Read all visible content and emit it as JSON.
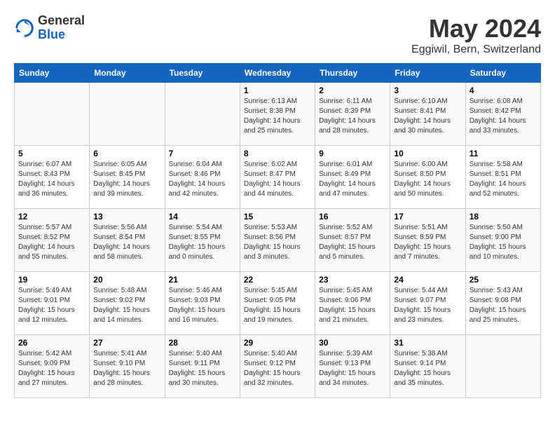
{
  "header": {
    "logo_general": "General",
    "logo_blue": "Blue",
    "month_title": "May 2024",
    "location": "Eggiwil, Bern, Switzerland"
  },
  "days_of_week": [
    "Sunday",
    "Monday",
    "Tuesday",
    "Wednesday",
    "Thursday",
    "Friday",
    "Saturday"
  ],
  "weeks": [
    [
      {
        "day": "",
        "info": ""
      },
      {
        "day": "",
        "info": ""
      },
      {
        "day": "",
        "info": ""
      },
      {
        "day": "1",
        "info": "Sunrise: 6:13 AM\nSunset: 8:38 PM\nDaylight: 14 hours and 25 minutes."
      },
      {
        "day": "2",
        "info": "Sunrise: 6:11 AM\nSunset: 8:39 PM\nDaylight: 14 hours and 28 minutes."
      },
      {
        "day": "3",
        "info": "Sunrise: 6:10 AM\nSunset: 8:41 PM\nDaylight: 14 hours and 30 minutes."
      },
      {
        "day": "4",
        "info": "Sunrise: 6:08 AM\nSunset: 8:42 PM\nDaylight: 14 hours and 33 minutes."
      }
    ],
    [
      {
        "day": "5",
        "info": "Sunrise: 6:07 AM\nSunset: 8:43 PM\nDaylight: 14 hours and 36 minutes."
      },
      {
        "day": "6",
        "info": "Sunrise: 6:05 AM\nSunset: 8:45 PM\nDaylight: 14 hours and 39 minutes."
      },
      {
        "day": "7",
        "info": "Sunrise: 6:04 AM\nSunset: 8:46 PM\nDaylight: 14 hours and 42 minutes."
      },
      {
        "day": "8",
        "info": "Sunrise: 6:02 AM\nSunset: 8:47 PM\nDaylight: 14 hours and 44 minutes."
      },
      {
        "day": "9",
        "info": "Sunrise: 6:01 AM\nSunset: 8:49 PM\nDaylight: 14 hours and 47 minutes."
      },
      {
        "day": "10",
        "info": "Sunrise: 6:00 AM\nSunset: 8:50 PM\nDaylight: 14 hours and 50 minutes."
      },
      {
        "day": "11",
        "info": "Sunrise: 5:58 AM\nSunset: 8:51 PM\nDaylight: 14 hours and 52 minutes."
      }
    ],
    [
      {
        "day": "12",
        "info": "Sunrise: 5:57 AM\nSunset: 8:52 PM\nDaylight: 14 hours and 55 minutes."
      },
      {
        "day": "13",
        "info": "Sunrise: 5:56 AM\nSunset: 8:54 PM\nDaylight: 14 hours and 58 minutes."
      },
      {
        "day": "14",
        "info": "Sunrise: 5:54 AM\nSunset: 8:55 PM\nDaylight: 15 hours and 0 minutes."
      },
      {
        "day": "15",
        "info": "Sunrise: 5:53 AM\nSunset: 8:56 PM\nDaylight: 15 hours and 3 minutes."
      },
      {
        "day": "16",
        "info": "Sunrise: 5:52 AM\nSunset: 8:57 PM\nDaylight: 15 hours and 5 minutes."
      },
      {
        "day": "17",
        "info": "Sunrise: 5:51 AM\nSunset: 8:59 PM\nDaylight: 15 hours and 7 minutes."
      },
      {
        "day": "18",
        "info": "Sunrise: 5:50 AM\nSunset: 9:00 PM\nDaylight: 15 hours and 10 minutes."
      }
    ],
    [
      {
        "day": "19",
        "info": "Sunrise: 5:49 AM\nSunset: 9:01 PM\nDaylight: 15 hours and 12 minutes."
      },
      {
        "day": "20",
        "info": "Sunrise: 5:48 AM\nSunset: 9:02 PM\nDaylight: 15 hours and 14 minutes."
      },
      {
        "day": "21",
        "info": "Sunrise: 5:46 AM\nSunset: 9:03 PM\nDaylight: 15 hours and 16 minutes."
      },
      {
        "day": "22",
        "info": "Sunrise: 5:45 AM\nSunset: 9:05 PM\nDaylight: 15 hours and 19 minutes."
      },
      {
        "day": "23",
        "info": "Sunrise: 5:45 AM\nSunset: 9:06 PM\nDaylight: 15 hours and 21 minutes."
      },
      {
        "day": "24",
        "info": "Sunrise: 5:44 AM\nSunset: 9:07 PM\nDaylight: 15 hours and 23 minutes."
      },
      {
        "day": "25",
        "info": "Sunrise: 5:43 AM\nSunset: 9:08 PM\nDaylight: 15 hours and 25 minutes."
      }
    ],
    [
      {
        "day": "26",
        "info": "Sunrise: 5:42 AM\nSunset: 9:09 PM\nDaylight: 15 hours and 27 minutes."
      },
      {
        "day": "27",
        "info": "Sunrise: 5:41 AM\nSunset: 9:10 PM\nDaylight: 15 hours and 28 minutes."
      },
      {
        "day": "28",
        "info": "Sunrise: 5:40 AM\nSunset: 9:11 PM\nDaylight: 15 hours and 30 minutes."
      },
      {
        "day": "29",
        "info": "Sunrise: 5:40 AM\nSunset: 9:12 PM\nDaylight: 15 hours and 32 minutes."
      },
      {
        "day": "30",
        "info": "Sunrise: 5:39 AM\nSunset: 9:13 PM\nDaylight: 15 hours and 34 minutes."
      },
      {
        "day": "31",
        "info": "Sunrise: 5:38 AM\nSunset: 9:14 PM\nDaylight: 15 hours and 35 minutes."
      },
      {
        "day": "",
        "info": ""
      }
    ]
  ]
}
